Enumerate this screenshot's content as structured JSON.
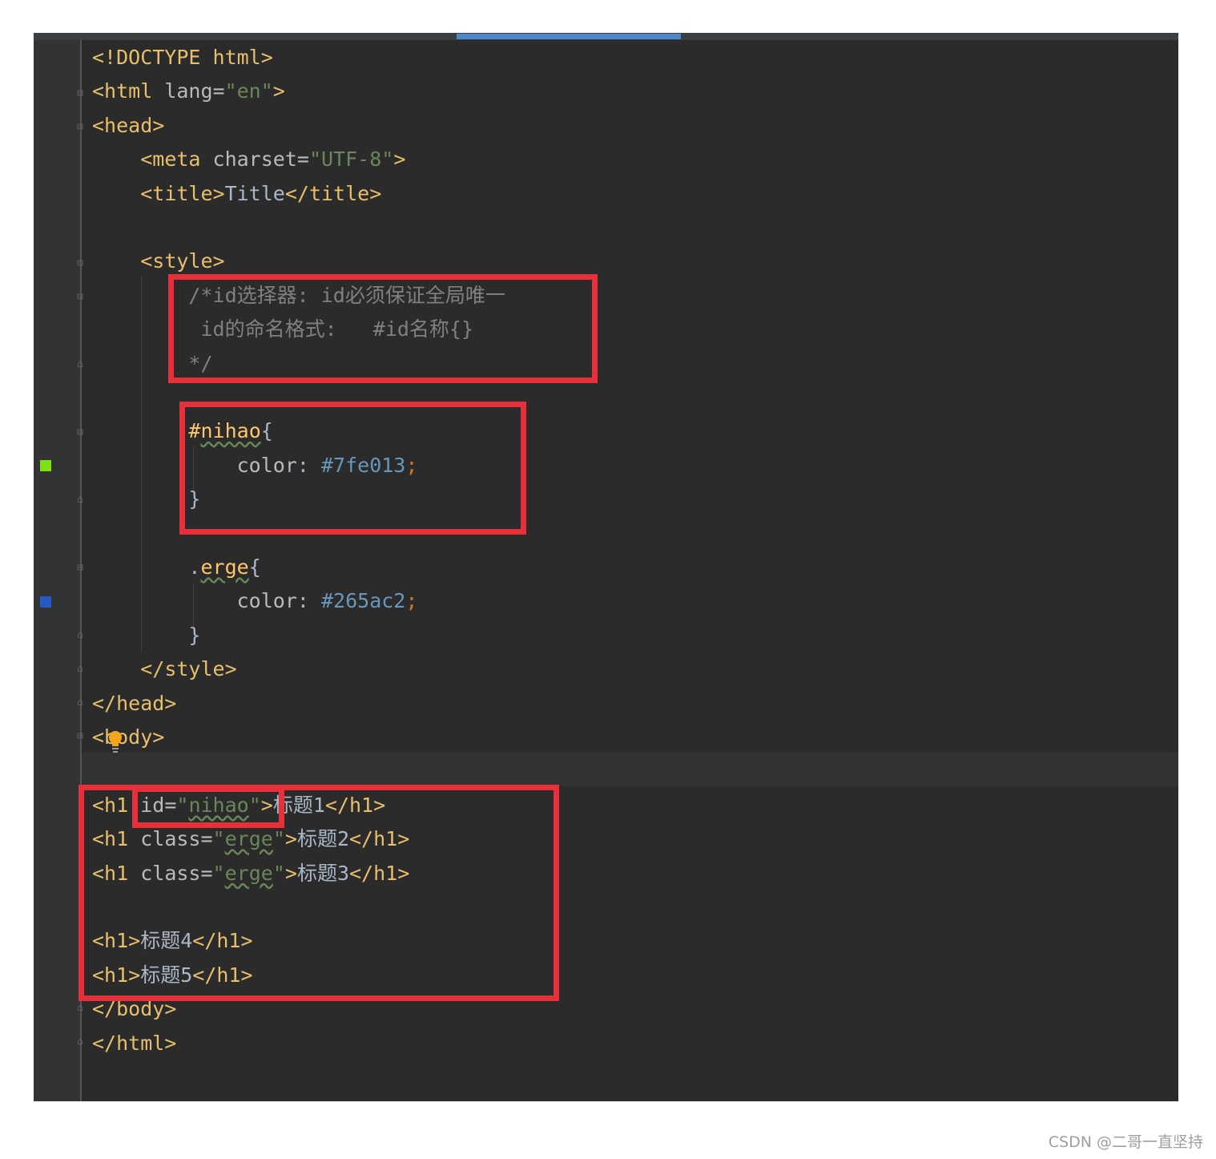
{
  "editor": {
    "lines": [
      [
        {
          "t": "<!DOCTYPE html>",
          "c": "tag"
        }
      ],
      [
        {
          "t": "<html ",
          "c": "tag"
        },
        {
          "t": "lang=",
          "c": "attr"
        },
        {
          "t": "\"en\"",
          "c": "str"
        },
        {
          "t": ">",
          "c": "tag"
        }
      ],
      [
        {
          "t": "<head>",
          "c": "tag"
        }
      ],
      [
        {
          "t": "    "
        },
        {
          "t": "<meta ",
          "c": "tag"
        },
        {
          "t": "charset=",
          "c": "attr"
        },
        {
          "t": "\"UTF-8\"",
          "c": "str"
        },
        {
          "t": ">",
          "c": "tag"
        }
      ],
      [
        {
          "t": "    "
        },
        {
          "t": "<title>",
          "c": "tag"
        },
        {
          "t": "Title"
        },
        {
          "t": "</title>",
          "c": "tag"
        }
      ],
      [],
      [
        {
          "t": "    "
        },
        {
          "t": "<style>",
          "c": "tag"
        }
      ],
      [
        {
          "t": "        "
        },
        {
          "t": "/*id选择器: id必须保证全局唯一",
          "c": "cmt"
        }
      ],
      [
        {
          "t": "         "
        },
        {
          "t": "id的命名格式:   #id名称{}",
          "c": "cmt"
        }
      ],
      [
        {
          "t": "        "
        },
        {
          "t": "*/",
          "c": "cmt"
        }
      ],
      [],
      [
        {
          "t": "        "
        },
        {
          "t": "#",
          "c": "sel"
        },
        {
          "t": "nihao",
          "c": "sel wavy"
        },
        {
          "t": "{"
        }
      ],
      [
        {
          "t": "            "
        },
        {
          "t": "color",
          "c": "attr"
        },
        {
          "t": ": "
        },
        {
          "t": "#7fe013",
          "c": "num"
        },
        {
          "t": ";",
          "c": "kw"
        }
      ],
      [
        {
          "t": "        "
        },
        {
          "t": "}"
        }
      ],
      [],
      [
        {
          "t": "        "
        },
        {
          "t": "."
        },
        {
          "t": "erge",
          "c": "sel wavy"
        },
        {
          "t": "{"
        }
      ],
      [
        {
          "t": "            "
        },
        {
          "t": "color",
          "c": "attr"
        },
        {
          "t": ": "
        },
        {
          "t": "#265ac2",
          "c": "num"
        },
        {
          "t": ";",
          "c": "kw"
        }
      ],
      [
        {
          "t": "        "
        },
        {
          "t": "}"
        }
      ],
      [
        {
          "t": "    "
        },
        {
          "t": "</style>",
          "c": "tag"
        }
      ],
      [
        {
          "t": "</head>",
          "c": "tag"
        }
      ],
      [
        {
          "t": "<body>",
          "c": "tag"
        }
      ],
      [],
      [
        {
          "t": "<h1 ",
          "c": "tag"
        },
        {
          "t": "id=",
          "c": "attr"
        },
        {
          "t": "\"",
          "c": "str"
        },
        {
          "t": "nihao",
          "c": "str wavy"
        },
        {
          "t": "\"",
          "c": "str"
        },
        {
          "t": ">",
          "c": "tag"
        },
        {
          "t": "标题1"
        },
        {
          "t": "</h1>",
          "c": "tag"
        }
      ],
      [
        {
          "t": "<h1 ",
          "c": "tag"
        },
        {
          "t": "class=",
          "c": "attr"
        },
        {
          "t": "\"",
          "c": "str"
        },
        {
          "t": "erge",
          "c": "str wavy"
        },
        {
          "t": "\"",
          "c": "str"
        },
        {
          "t": ">",
          "c": "tag"
        },
        {
          "t": "标题2"
        },
        {
          "t": "</h1>",
          "c": "tag"
        }
      ],
      [
        {
          "t": "<h1 ",
          "c": "tag"
        },
        {
          "t": "class=",
          "c": "attr"
        },
        {
          "t": "\"",
          "c": "str"
        },
        {
          "t": "erge",
          "c": "str wavy"
        },
        {
          "t": "\"",
          "c": "str"
        },
        {
          "t": ">",
          "c": "tag"
        },
        {
          "t": "标题3"
        },
        {
          "t": "</h1>",
          "c": "tag"
        }
      ],
      [],
      [
        {
          "t": "<h1>",
          "c": "tag"
        },
        {
          "t": "标题4"
        },
        {
          "t": "</h1>",
          "c": "tag"
        }
      ],
      [
        {
          "t": "<h1>",
          "c": "tag"
        },
        {
          "t": "标题5"
        },
        {
          "t": "</h1>",
          "c": "tag"
        }
      ],
      [
        {
          "t": "</body>",
          "c": "tag"
        }
      ],
      [
        {
          "t": "</html>",
          "c": "tag"
        }
      ]
    ],
    "color_swatches": [
      "#7fe013",
      "#265ac2"
    ],
    "accent": "#4a88c7",
    "highlight_color": "#e8303a"
  },
  "watermark": "CSDN @二哥一直坚持"
}
